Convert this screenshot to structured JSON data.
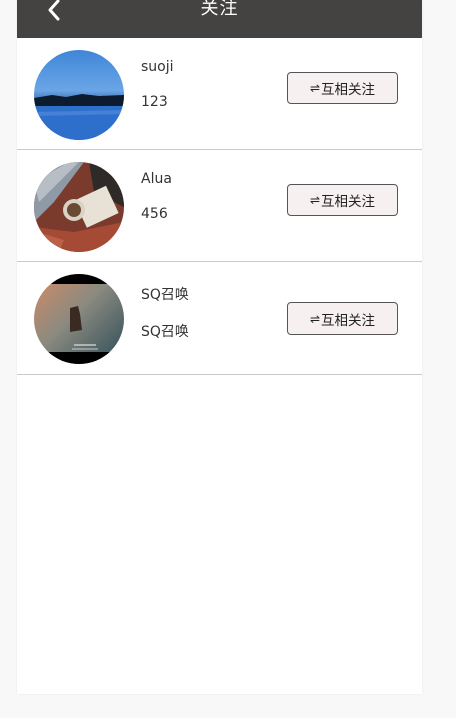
{
  "header": {
    "title": "关注",
    "background": "#454341"
  },
  "follow_list": [
    {
      "name": "suoji",
      "subtitle": "123",
      "button_label": "互相关注",
      "button_icon": "swap-arrows-icon"
    },
    {
      "name": "Alua",
      "subtitle": "456",
      "button_label": "互相关注",
      "button_icon": "swap-arrows-icon"
    },
    {
      "name": "SQ召唤",
      "subtitle": "SQ召唤",
      "button_label": "互相关注",
      "button_icon": "swap-arrows-icon"
    }
  ],
  "colors": {
    "button_bg": "#f6f1f0",
    "divider": "#c9c9c9"
  }
}
